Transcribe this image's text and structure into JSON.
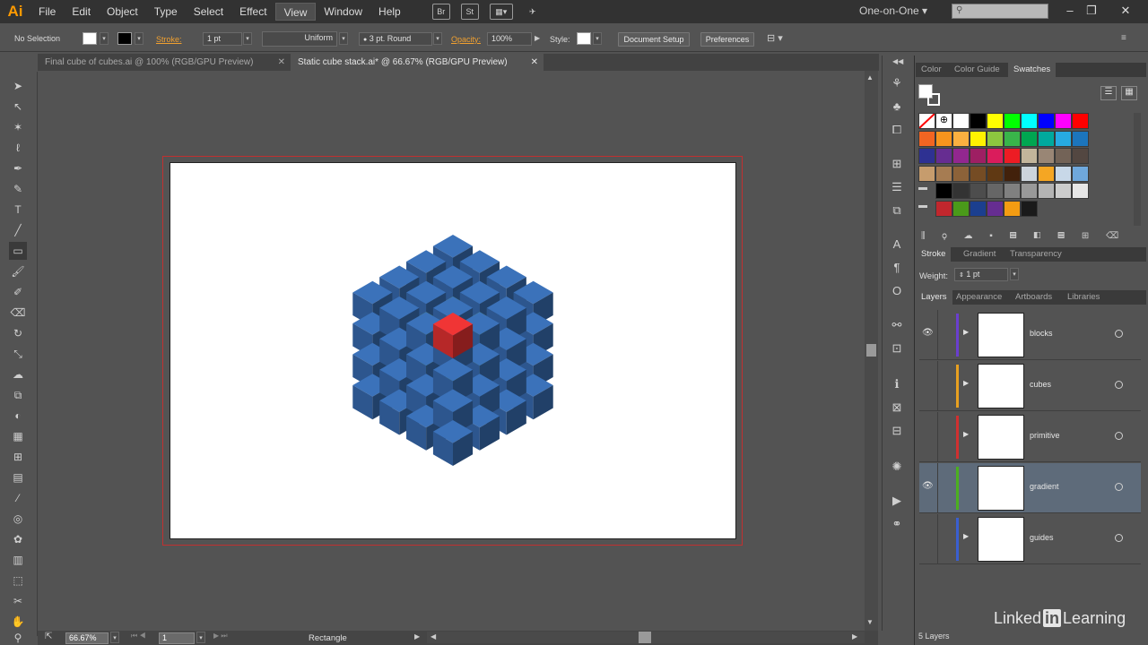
{
  "menubar": {
    "logo": "Ai",
    "items": [
      "File",
      "Edit",
      "Object",
      "Type",
      "Select",
      "Effect",
      "View",
      "Window",
      "Help"
    ],
    "icons": [
      "Br",
      "St"
    ],
    "workspace": "One-on-One"
  },
  "controlbar": {
    "selection_label": "No Selection",
    "stroke_label": "Stroke:",
    "stroke_weight": "1 pt",
    "stroke_profile": "Uniform",
    "brush": "3 pt. Round",
    "opacity_label": "Opacity:",
    "opacity_value": "100%",
    "style_label": "Style:",
    "document_setup": "Document Setup",
    "preferences": "Preferences"
  },
  "tabs": [
    {
      "label": "Final cube of cubes.ai @ 100% (RGB/GPU Preview)"
    },
    {
      "label": "Static cube stack.ai* @ 66.67% (RGB/GPU Preview)"
    }
  ],
  "statusbar": {
    "zoom": "66.67%",
    "artboard": "1",
    "tool": "Rectangle"
  },
  "swatches_panel": {
    "tabs": [
      "Color",
      "Color Guide",
      "Swatches"
    ],
    "rows": [
      [
        "none",
        "reg",
        "#ffffff",
        "#000000",
        "#ffff00",
        "#00ff00",
        "#00ffff",
        "#0000ff",
        "#ff00ff",
        "#ff0000"
      ],
      [
        "#f26522",
        "#f7941d",
        "#fbb040",
        "#fff200",
        "#8dc63f",
        "#39b54a",
        "#00a651",
        "#00a99d",
        "#27aae1",
        "#1c75bc"
      ],
      [
        "#2e3192",
        "#662d91",
        "#92278f",
        "#9e1f63",
        "#da1c5c",
        "#ed1c24",
        "#c2b59b",
        "#998675",
        "#736357",
        "#534741"
      ],
      [
        "#c69c6d",
        "#a67c52",
        "#8c6239",
        "#754c24",
        "#603913",
        "#42210b",
        "#ccd4dc",
        "#f5a623",
        "#c8d8e8",
        "#6fa8dc"
      ],
      [
        "folder",
        "#000000",
        "#333333",
        "#4d4d4d",
        "#666666",
        "#808080",
        "#999999",
        "#b3b3b3",
        "#cccccc",
        "#e6e6e6"
      ],
      [
        "folder",
        "#c1272d",
        "#4a9a1a",
        "#1b3f8f",
        "#662d91",
        "#f39c12",
        "#1a1a1a"
      ]
    ]
  },
  "stroke_panel": {
    "tabs": [
      "Stroke",
      "Gradient",
      "Transparency"
    ],
    "weight_label": "Weight:",
    "weight_value": "1 pt"
  },
  "layers_panel": {
    "tabs": [
      "Layers",
      "Appearance",
      "Artboards",
      "Libraries"
    ],
    "layers": [
      {
        "name": "blocks",
        "color": "#6a3fcf",
        "visible": true
      },
      {
        "name": "cubes",
        "color": "#e8a020",
        "visible": false
      },
      {
        "name": "primitive",
        "color": "#d03030",
        "visible": false
      },
      {
        "name": "gradient",
        "color": "#4caf20",
        "visible": true
      },
      {
        "name": "guides",
        "color": "#3a5fd0",
        "visible": false
      }
    ],
    "count": "5 Layers"
  },
  "watermark": {
    "brand_a": "Linked",
    "brand_b": "in",
    "brand_c": "Learning"
  },
  "artwork": {
    "colors": {
      "purple": "#5e4570",
      "blue": "#2f5b95",
      "green": "#6a9a2a",
      "red": "#c02a2a"
    }
  }
}
